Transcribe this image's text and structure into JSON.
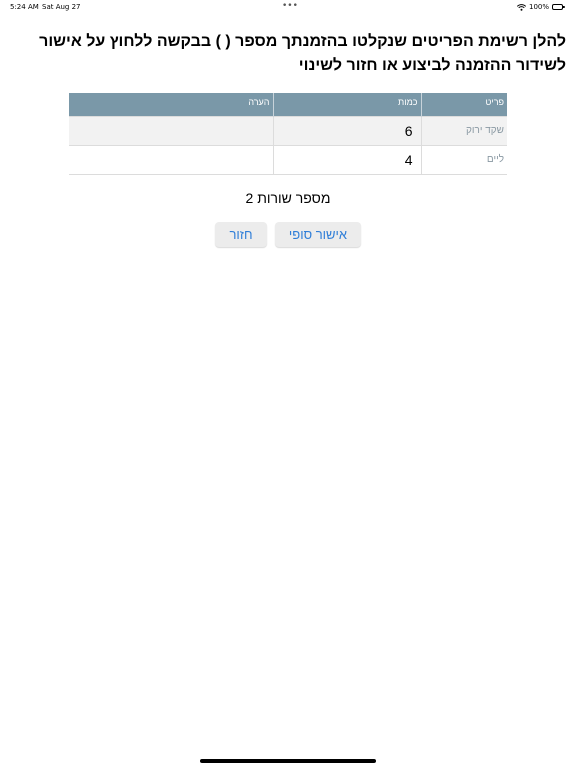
{
  "status_bar": {
    "time": "5:24 AM",
    "date": "Sat Aug 27",
    "dots": "•••",
    "battery": "100%",
    "icons": [
      "wifi-icon",
      "battery-icon"
    ]
  },
  "title": "להלן רשימת הפריטים שנקלטו בהזמנתך מספר ( ) בבקשה ללחוץ על אישור לשידור ההזמנה לביצוע או חזור לשינוי",
  "table": {
    "headers": {
      "item": "פריט",
      "quantity": "כמות",
      "note": "הערה"
    },
    "rows": [
      {
        "item": "שקד ירוק",
        "quantity": "6",
        "note": ""
      },
      {
        "item": "ליים",
        "quantity": "4",
        "note": ""
      }
    ]
  },
  "row_count": "מספר שורות 2",
  "buttons": {
    "confirm": "אישור סופי",
    "back": "חזור"
  },
  "colors": {
    "header_bg": "#7a98a8",
    "button_text": "#2f7ed8",
    "button_bg": "#ececec"
  }
}
